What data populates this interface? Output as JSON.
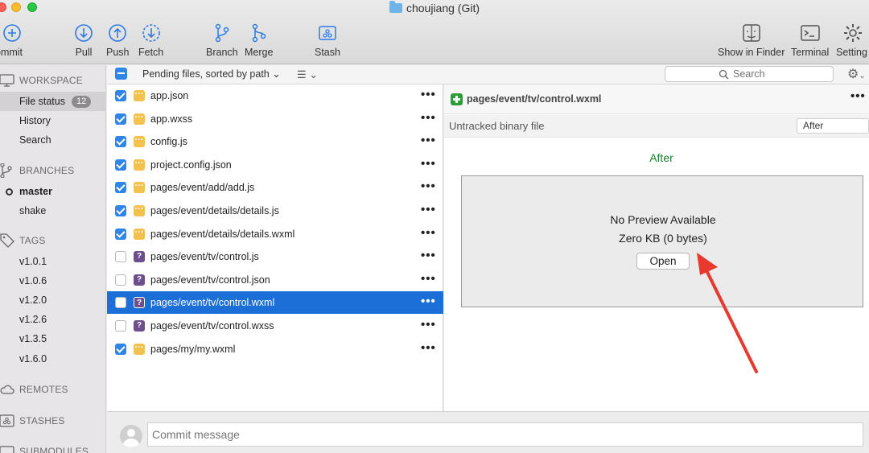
{
  "window": {
    "title": "choujiang (Git)"
  },
  "toolbar": {
    "commit": "ommit",
    "pull": "Pull",
    "push": "Push",
    "fetch": "Fetch",
    "branch": "Branch",
    "merge": "Merge",
    "stash": "Stash",
    "show_in_finder": "Show in Finder",
    "terminal": "Terminal",
    "settings": "Setting"
  },
  "sidebar": {
    "workspace": {
      "header": "WORKSPACE",
      "items": [
        {
          "label": "File status",
          "badge": "12"
        },
        {
          "label": "History"
        },
        {
          "label": "Search"
        }
      ]
    },
    "branches": {
      "header": "BRANCHES",
      "items": [
        {
          "label": "master"
        },
        {
          "label": "shake"
        }
      ]
    },
    "tags": {
      "header": "TAGS",
      "items": [
        {
          "label": "v1.0.1"
        },
        {
          "label": "v1.0.6"
        },
        {
          "label": "v1.2.0"
        },
        {
          "label": "v1.2.6"
        },
        {
          "label": "v1.3.5"
        },
        {
          "label": "v1.6.0"
        }
      ]
    },
    "remotes": {
      "header": "REMOTES"
    },
    "stashes": {
      "header": "STASHES"
    },
    "submodules": {
      "header": "SUBMODULES"
    }
  },
  "filebar": {
    "sort_label": "Pending files, sorted by path",
    "search_placeholder": "Search"
  },
  "files": [
    {
      "name": "app.json",
      "status": "modified",
      "staged": true
    },
    {
      "name": "app.wxss",
      "status": "modified",
      "staged": true
    },
    {
      "name": "config.js",
      "status": "modified",
      "staged": true
    },
    {
      "name": "project.config.json",
      "status": "modified",
      "staged": true
    },
    {
      "name": "pages/event/add/add.js",
      "status": "modified",
      "staged": true
    },
    {
      "name": "pages/event/details/details.js",
      "status": "modified",
      "staged": true
    },
    {
      "name": "pages/event/details/details.wxml",
      "status": "modified",
      "staged": true
    },
    {
      "name": "pages/event/tv/control.js",
      "status": "untracked",
      "staged": false
    },
    {
      "name": "pages/event/tv/control.json",
      "status": "untracked",
      "staged": false
    },
    {
      "name": "pages/event/tv/control.wxml",
      "status": "untracked",
      "staged": false,
      "selected": true
    },
    {
      "name": "pages/event/tv/control.wxss",
      "status": "untracked",
      "staged": false
    },
    {
      "name": "pages/my/my.wxml",
      "status": "modified",
      "staged": true
    }
  ],
  "diff": {
    "path": "pages/event/tv/control.wxml",
    "subtitle": "Untracked binary file",
    "view_select": "After",
    "after_title": "After",
    "no_preview": "No Preview Available",
    "size": "Zero KB (0 bytes)",
    "open_label": "Open"
  },
  "commit": {
    "placeholder": "Commit message"
  },
  "colors": {
    "accent": "#1b6fd6",
    "annotation": "#e8392f",
    "added": "#2e9b3a"
  }
}
